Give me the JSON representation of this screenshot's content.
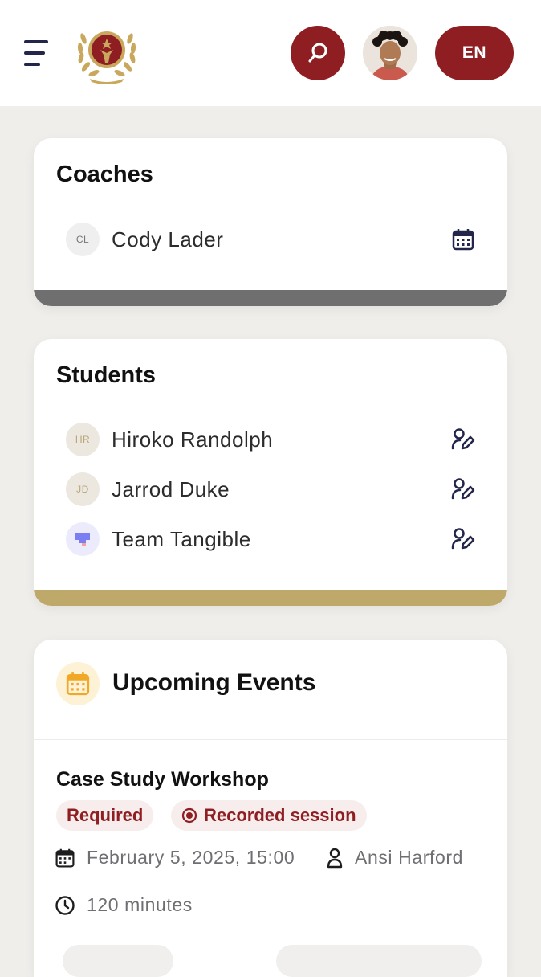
{
  "header": {
    "lang_label": "EN",
    "colors": {
      "brand": "#8f1e22",
      "gold": "#c9a85e",
      "navy": "#23264a"
    }
  },
  "coaches": {
    "title": "Coaches",
    "items": [
      {
        "initials": "CL",
        "name": "Cody Lader",
        "action_icon": "calendar-icon"
      }
    ],
    "bar_color": "#6f6f6f"
  },
  "students": {
    "title": "Students",
    "items": [
      {
        "initials": "HR",
        "name": "Hiroko Randolph",
        "action_icon": "edit-user-icon"
      },
      {
        "initials": "JD",
        "name": "Jarrod Duke",
        "action_icon": "edit-user-icon"
      },
      {
        "initials": "",
        "name": "Team Tangible",
        "action_icon": "edit-user-icon"
      }
    ],
    "bar_color": "#bea96b"
  },
  "events": {
    "title": "Upcoming Events",
    "items": [
      {
        "title": "Case Study Workshop",
        "badges": [
          "Required",
          "Recorded session"
        ],
        "date": "February 5, 2025, 15:00",
        "host": "Ansi Harford",
        "duration": "120 minutes"
      }
    ]
  }
}
